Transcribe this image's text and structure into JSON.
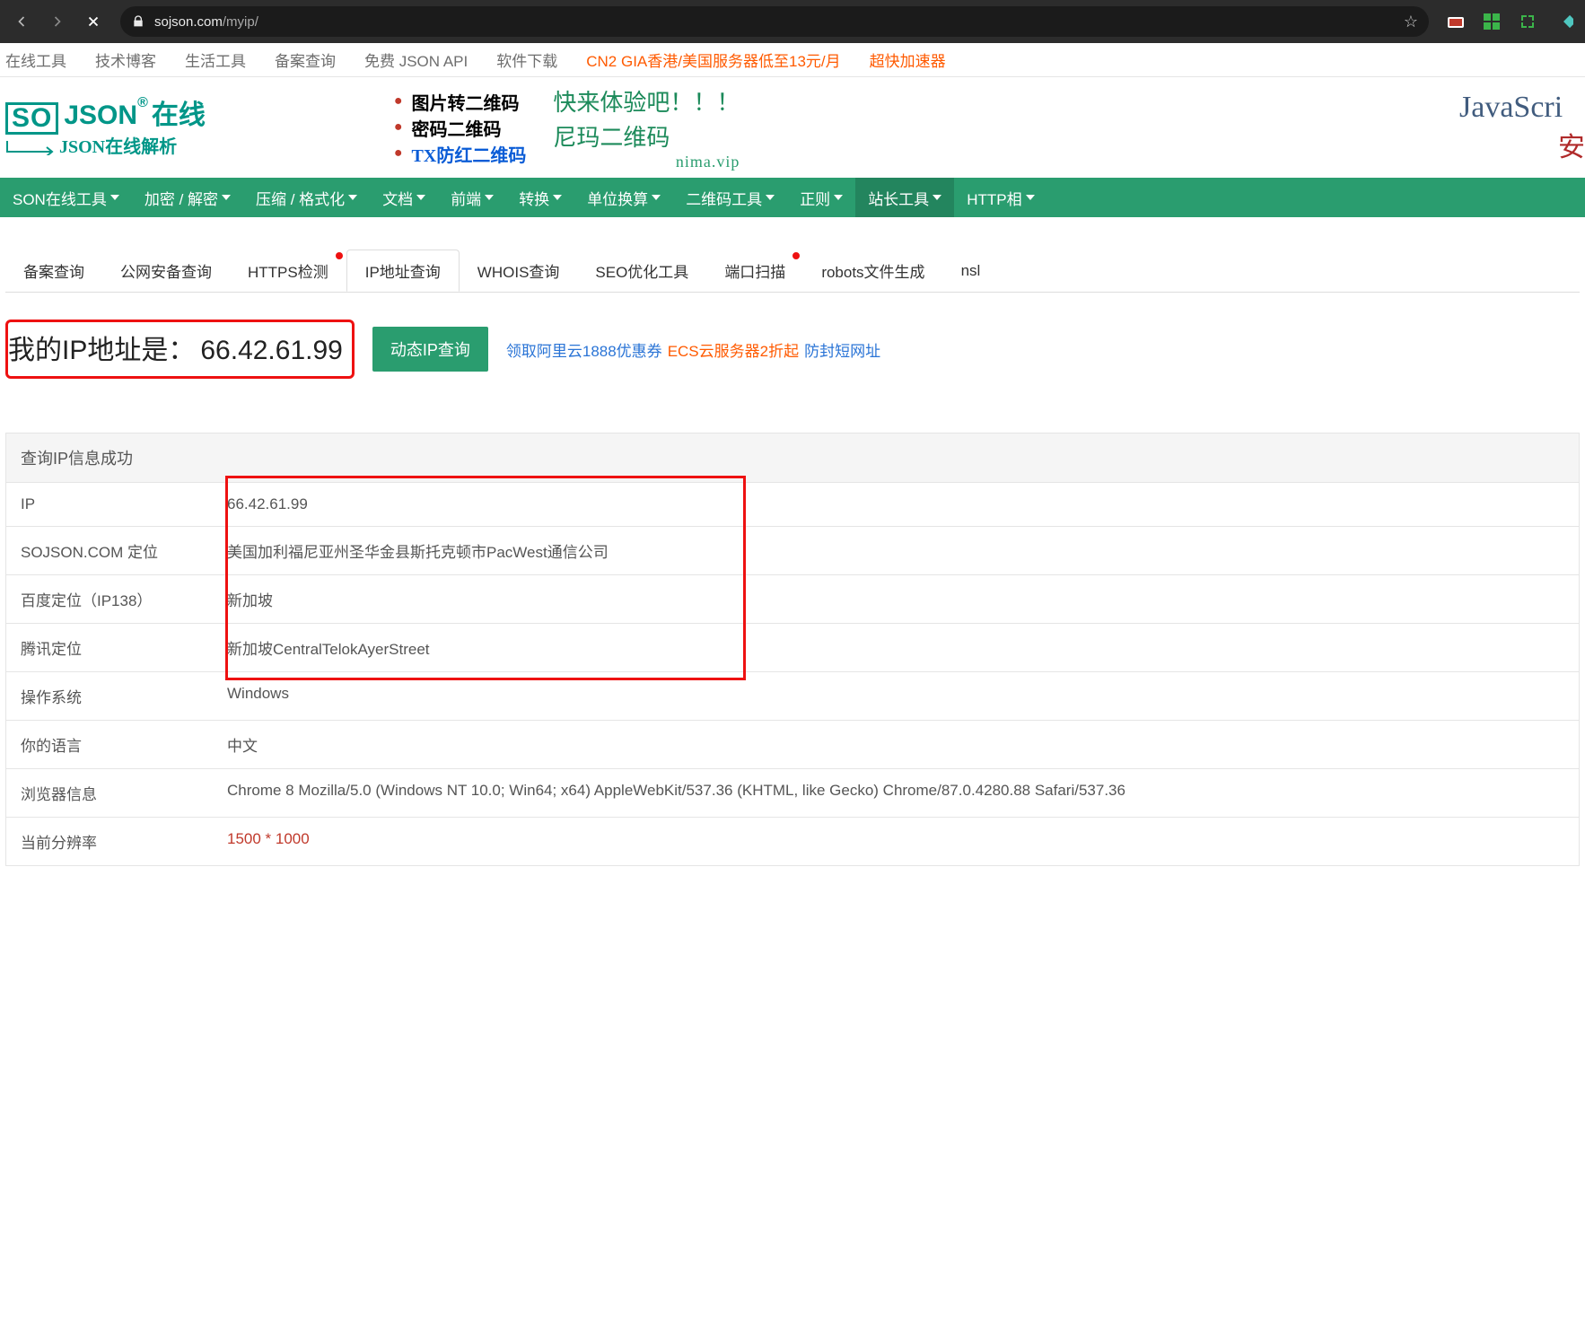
{
  "browser": {
    "url_host": "sojson.com",
    "url_path": "/myip/"
  },
  "top_links": [
    "在线工具",
    "技术博客",
    "生活工具",
    "备案查询",
    "免费 JSON API",
    "软件下载"
  ],
  "top_promos": [
    "CN2 GIA香港/美国服务器低至13元/月",
    "超快加速器"
  ],
  "logo": {
    "box": "SO",
    "json": "JSON",
    "reg": "®",
    "cn1": "在线",
    "sub": "JSON在线解析"
  },
  "promo_list": [
    "图片转二维码",
    "密码二维码",
    "TX防红二维码"
  ],
  "hand": {
    "l1": "快来体验吧！！！",
    "l2": "尼玛二维码",
    "sub": "nima.vip"
  },
  "js_banner": {
    "top": "JavaScri",
    "bot": "安"
  },
  "nav_items": [
    "SON在线工具",
    "加密 / 解密",
    "压缩 / 格式化",
    "文档",
    "前端",
    "转换",
    "单位换算",
    "二维码工具",
    "正则",
    "站长工具",
    "HTTP相"
  ],
  "nav_active_index": 9,
  "subtabs": [
    {
      "label": "备案查询",
      "dot": false
    },
    {
      "label": "公网安备查询",
      "dot": false
    },
    {
      "label": "HTTPS检测",
      "dot": true
    },
    {
      "label": "IP地址查询",
      "dot": false,
      "active": true
    },
    {
      "label": "WHOIS查询",
      "dot": false
    },
    {
      "label": "SEO优化工具",
      "dot": false
    },
    {
      "label": "端口扫描",
      "dot": true
    },
    {
      "label": "robots文件生成",
      "dot": false
    },
    {
      "label": "nsl",
      "dot": false
    }
  ],
  "ip_section": {
    "label": "我的IP地址是：",
    "ip": "66.42.61.99",
    "button": "动态IP查询",
    "links": [
      {
        "text": "领取阿里云1888优惠券",
        "cls": "lnk-blue"
      },
      {
        "text": "ECS云服务器2折起",
        "cls": "lnk-orange"
      },
      {
        "text": "防封短网址",
        "cls": "lnk-blue"
      }
    ]
  },
  "result": {
    "title": "查询IP信息成功",
    "rows": [
      {
        "label": "IP",
        "value": "66.42.61.99"
      },
      {
        "label": "SOJSON.COM 定位",
        "value": "美国加利福尼亚州圣华金县斯托克顿市PacWest通信公司"
      },
      {
        "label": "百度定位（IP138）",
        "value": "新加坡"
      },
      {
        "label": "腾讯定位",
        "value": "新加坡CentralTelokAyerStreet"
      },
      {
        "label": "操作系统",
        "value": "Windows"
      },
      {
        "label": "你的语言",
        "value": "中文"
      },
      {
        "label": "浏览器信息",
        "value": "Chrome 8 Mozilla/5.0 (Windows NT 10.0; Win64; x64) AppleWebKit/537.36 (KHTML, like Gecko) Chrome/87.0.4280.88 Safari/537.36"
      },
      {
        "label": "当前分辨率",
        "value": "1500 * 1000",
        "last": true
      }
    ]
  }
}
